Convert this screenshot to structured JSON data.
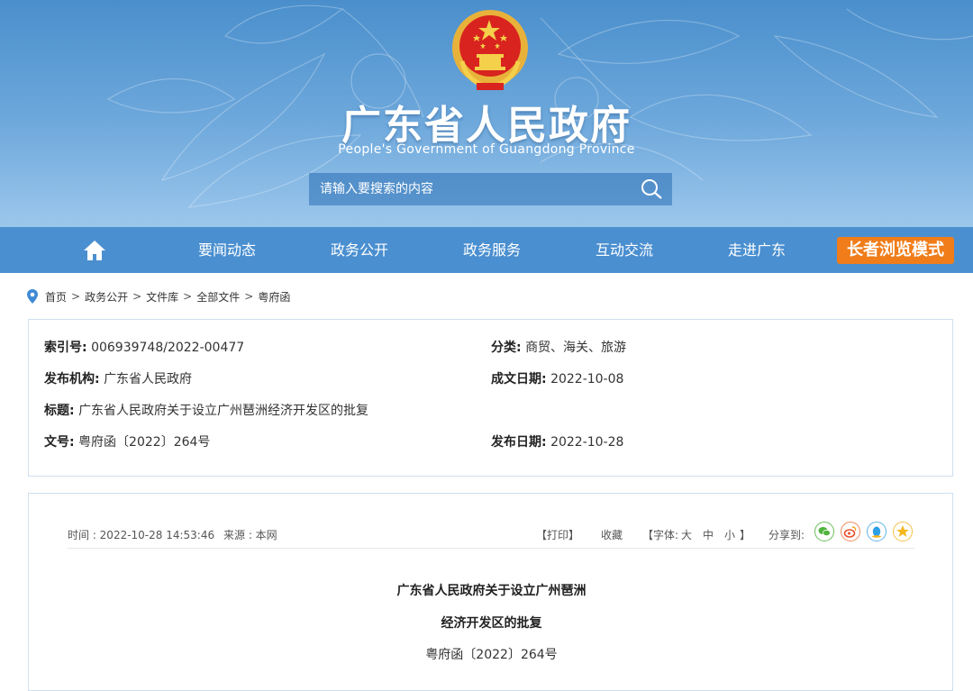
{
  "header": {
    "title": "广东省人民政府",
    "subtitle": "People's Government of Guangdong Province",
    "search_placeholder": "请输入要搜索的内容"
  },
  "nav": {
    "items": [
      "要闻动态",
      "政务公开",
      "政务服务",
      "互动交流",
      "走进广东"
    ],
    "elder_mode": "长者浏览模式"
  },
  "breadcrumb": [
    "首页",
    "政务公开",
    "文件库",
    "全部文件",
    "粤府函"
  ],
  "meta": {
    "index_label": "索引号:",
    "index_value": "006939748/2022-00477",
    "category_label": "分类:",
    "category_value": "商贸、海关、旅游",
    "issuer_label": "发布机构:",
    "issuer_value": "广东省人民政府",
    "written_label": "成文日期:",
    "written_value": "2022-10-08",
    "title_label": "标题:",
    "title_value": "广东省人民政府关于设立广州琶洲经济开发区的批复",
    "docno_label": "文号:",
    "docno_value": "粤府函〔2022〕264号",
    "publish_label": "发布日期:",
    "publish_value": "2022-10-28"
  },
  "article": {
    "time": "时间 : 2022-10-28 14:53:46",
    "source": "来源 : 本网",
    "print": "【打印】",
    "favorite": "收藏",
    "font_prefix": "【字体:",
    "font_large": "大",
    "font_medium": "中",
    "font_small": "小",
    "font_suffix": "】",
    "share": "分享到:",
    "title_line1": "广东省人民政府关于设立广州琶洲",
    "title_line2": "经济开发区的批复",
    "doc_number": "粤府函〔2022〕264号"
  },
  "colors": {
    "nav_bg": "#4a8fd0",
    "elder_btn": "#f07d1a",
    "box_border": "#cfe0ee"
  }
}
